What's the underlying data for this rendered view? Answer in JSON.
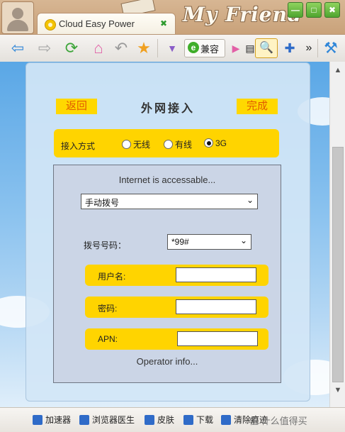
{
  "tab": {
    "title": "Cloud Easy Power",
    "close_glyph": "✖"
  },
  "brand": "My Friend",
  "window_buttons": {
    "minimize": "—",
    "maximize": "□",
    "close": "✖"
  },
  "toolbar": {
    "back_icon": "back-arrow-icon",
    "forward_icon": "forward-arrow-icon",
    "refresh_icon": "refresh-icon",
    "home_icon": "home-icon",
    "undo_icon": "undo-icon",
    "favorite_icon": "star-icon",
    "compat_label": "兼容",
    "more_label": "»"
  },
  "page": {
    "back_label": "返回",
    "title": "外网接入",
    "done_label": "完成",
    "mode_label": "接入方式",
    "modes": [
      {
        "label": "无线",
        "checked": false
      },
      {
        "label": "有线",
        "checked": false
      },
      {
        "label": "3G",
        "checked": true
      }
    ],
    "status_text": "Internet is accessable...",
    "dial_mode_value": "手动拨号",
    "dial_code_label": "拨号号码：",
    "dial_code_value": "*99#",
    "username_label": "用户名:",
    "password_label": "密码:",
    "apn_label": "APN:",
    "username_value": "",
    "password_value": "",
    "apn_value": "",
    "operator_text": "Operator info..."
  },
  "statusbar": {
    "items": [
      "加速器",
      "浏览器医生",
      "皮肤",
      "下载",
      "清除痕迹"
    ],
    "watermark": "值 什么值得买"
  },
  "colors": {
    "accent_yellow": "#ffd800",
    "link_orange": "#e15b00",
    "sky_blue": "#5aa7e6"
  }
}
